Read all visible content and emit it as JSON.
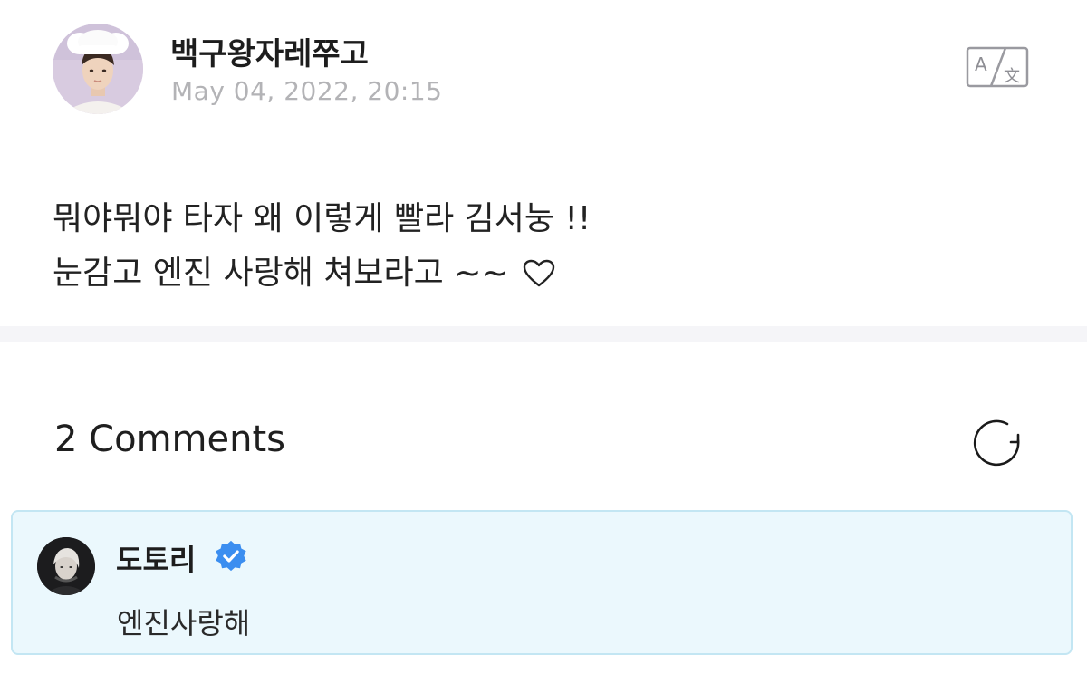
{
  "post": {
    "author": "백구왕자레쭈고",
    "date": "May 04, 2022, 20:15",
    "line1": "뭐야뭐야 타자 왜 이렇게 빨라 김서눙 !!",
    "line2": "눈감고 엔진 사랑해 쳐보라고 ~~",
    "line2_icon": "heart-outline-icon",
    "translate_icon": "translate-icon"
  },
  "comments": {
    "heading": "2 Comments",
    "refresh_icon": "refresh-icon",
    "items": [
      {
        "author": "도토리",
        "verified": true,
        "verified_color": "#3b8ef0",
        "text": "엔진사랑해"
      }
    ]
  },
  "colors": {
    "date_text": "#b3b3b6",
    "divider": "#f5f5f8",
    "comment_card_bg": "#ebf8fd",
    "comment_card_border": "#c3e6f3"
  }
}
